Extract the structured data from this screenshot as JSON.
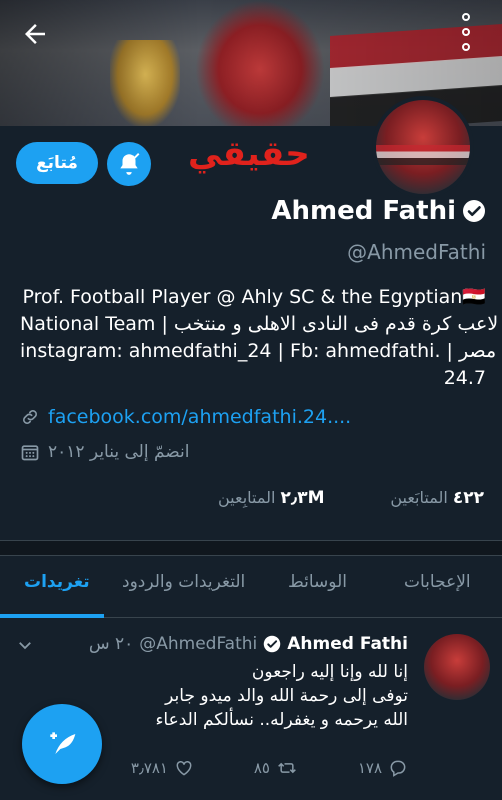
{
  "header": {
    "back_icon": "arrow-left-icon",
    "menu_icon": "more-vertical-icon"
  },
  "profile": {
    "follow_label": "مُتابَع",
    "bell_icon": "bell-check-icon",
    "real_label": "حقيقي",
    "name": "Ahmed Fathi",
    "verified_icon": "verified-badge-icon",
    "handle": "@AhmedFathi",
    "bio_lines": [
      "Prof. Football Player @ Ahly SC & the Egyptian🇪🇬",
      "National Team | لاعب كرة قدم فى النادى الاهلى و منتخب",
      "instagram: ahmedfathi_24 | Fb: ahmedfathi. | مصر",
      "24.7"
    ],
    "link_icon": "link-icon",
    "link": "facebook.com/ahmedfathi.24....",
    "calendar_icon": "calendar-icon",
    "joined": "انضمّ إلى يناير ٢٠١٢",
    "following_count": "٤٢٢",
    "following_label": "المتابَعين",
    "followers_count": "٢٫٣M",
    "followers_label": "المتابِعين"
  },
  "tabs": [
    {
      "label": "تغريدات",
      "active": true
    },
    {
      "label": "التغريدات والردود",
      "active": false
    },
    {
      "label": "الوسائط",
      "active": false
    },
    {
      "label": "الإعجابات",
      "active": false
    }
  ],
  "tweet": {
    "name": "Ahmed Fathi",
    "handle": "@AhmedFathi",
    "time": "٢٠ س",
    "lines": [
      "إنا لله وإنا إليه راجعون",
      "توفى إلى رحمة الله والد ميدو جابر",
      "الله يرحمه و يغفرله.. نسألكم الدعاء"
    ],
    "reply_count": "١٧٨",
    "retweet_count": "٨٥",
    "like_count": "٣٫٧٨١"
  },
  "fab": {
    "icon": "compose-tweet-icon"
  },
  "colors": {
    "accent": "#1da1f2",
    "background": "#15202b",
    "muted": "#8899a6",
    "real_label": "#e0221c"
  }
}
